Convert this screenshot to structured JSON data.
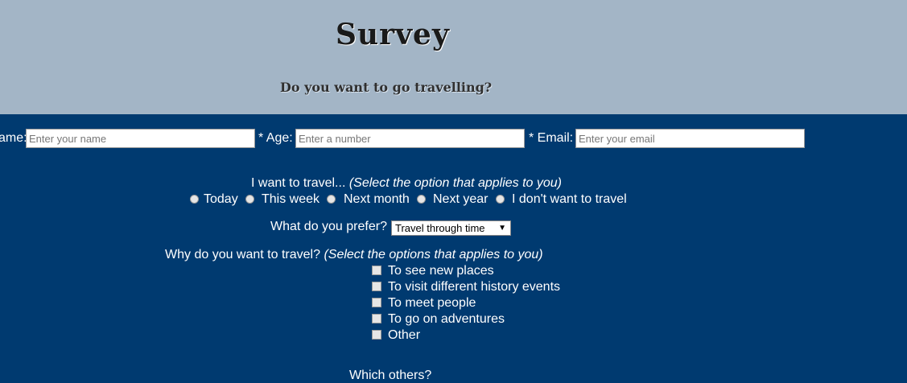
{
  "header": {
    "title": "Survey",
    "subtitle": "Do you want to go travelling?"
  },
  "fields": {
    "name_label": "ame:",
    "name_placeholder": "Enter your name",
    "age_label": "* Age:",
    "age_placeholder": "Enter a number",
    "email_label": "* Email:",
    "email_placeholder": "Enter your email"
  },
  "travel_when": {
    "question": "I want to travel...",
    "hint": "(Select the option that applies to you)",
    "options": [
      "Today",
      "This week",
      "Next month",
      "Next year",
      "I don't want to travel"
    ]
  },
  "preference": {
    "question": "What do you prefer?",
    "selected": "Travel through time"
  },
  "reasons": {
    "question": "Why do you want to travel?",
    "hint": "(Select the options that applies to you)",
    "options": [
      "To see new places",
      "To visit different history events",
      "To meet people",
      "To go on adventures",
      "Other"
    ]
  },
  "others": {
    "question": "Which others?"
  }
}
